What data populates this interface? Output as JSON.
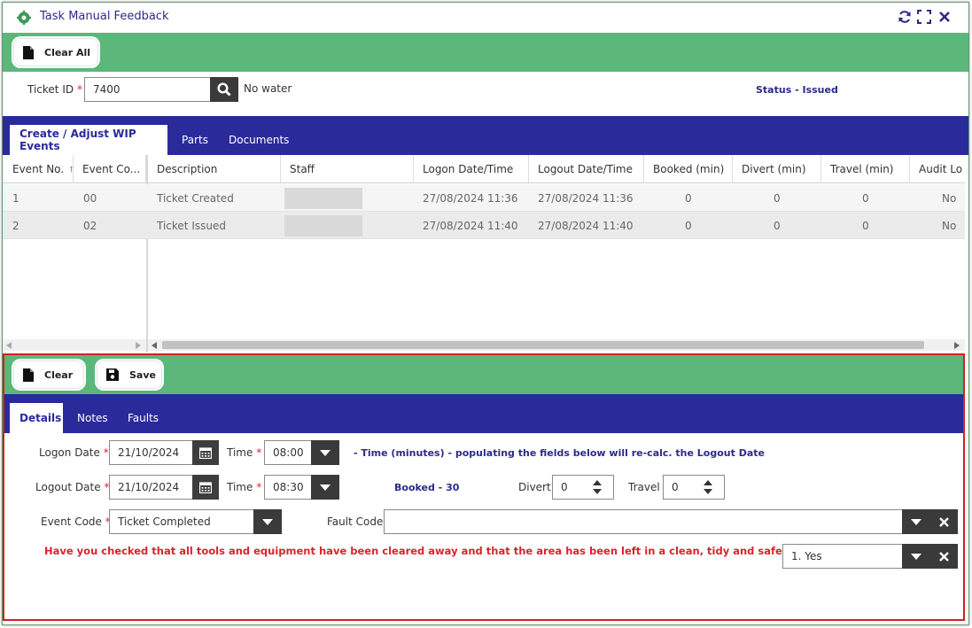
{
  "window": {
    "title": "Task Manual Feedback",
    "controls": [
      "refresh-icon",
      "maximize-icon",
      "close-icon"
    ]
  },
  "toolbar_top": {
    "clear_all_label": "Clear All"
  },
  "ticket": {
    "id_label": "Ticket ID",
    "required_marker": "*",
    "id_value": "7400",
    "description": "No water",
    "status_label": "Status -",
    "status_value": "Issued"
  },
  "tabs_top": [
    {
      "label": "Create / Adjust WIP Events",
      "active": true
    },
    {
      "label": "Parts",
      "active": false
    },
    {
      "label": "Documents",
      "active": false
    }
  ],
  "grid": {
    "columns": [
      "Event No.",
      "Event Co...",
      "Description",
      "Staff",
      "Logon Date/Time",
      "Logout Date/Time",
      "Booked (min)",
      "Divert (min)",
      "Travel (min)",
      "Audit Lo"
    ],
    "rows": [
      {
        "event_no": "1",
        "event_code": "00",
        "description": "Ticket Created",
        "staff": "",
        "logon": "27/08/2024 11:36",
        "logout": "27/08/2024 11:36",
        "booked": "0",
        "divert": "0",
        "travel": "0",
        "audit": "No"
      },
      {
        "event_no": "2",
        "event_code": "02",
        "description": "Ticket Issued",
        "staff": "",
        "logon": "27/08/2024 11:40",
        "logout": "27/08/2024 11:40",
        "booked": "0",
        "divert": "0",
        "travel": "0",
        "audit": "No"
      }
    ]
  },
  "toolbar_bottom": {
    "clear_label": "Clear",
    "save_label": "Save"
  },
  "tabs_bottom": [
    {
      "label": "Details",
      "active": true
    },
    {
      "label": "Notes",
      "active": false
    },
    {
      "label": "Faults",
      "active": false
    }
  ],
  "details": {
    "logon_date_label": "Logon Date",
    "logon_date_value": "21/10/2024",
    "time_label": "Time",
    "logon_time_value": "08:00",
    "time_hint": "- Time (minutes) - populating the fields below will re-calc. the Logout Date",
    "logout_date_label": "Logout Date",
    "logout_date_value": "21/10/2024",
    "logout_time_value": "08:30",
    "booked_label": "Booked -",
    "booked_value": "30",
    "divert_label": "Divert",
    "divert_value": "0",
    "travel_label": "Travel",
    "travel_value": "0",
    "event_code_label": "Event Code",
    "event_code_value": "Ticket Completed",
    "fault_code_label": "Fault Code",
    "fault_code_value": "",
    "question": "Have you checked that all tools and equipment have been cleared away and that the area has been left in a clean, tidy and safe manner?",
    "answer_value": "1. Yes"
  },
  "colors": {
    "green_bar": "#5bb87a",
    "tab_bar": "#2a2a9a",
    "required": "#d9232e",
    "panel_border": "#d42020"
  }
}
